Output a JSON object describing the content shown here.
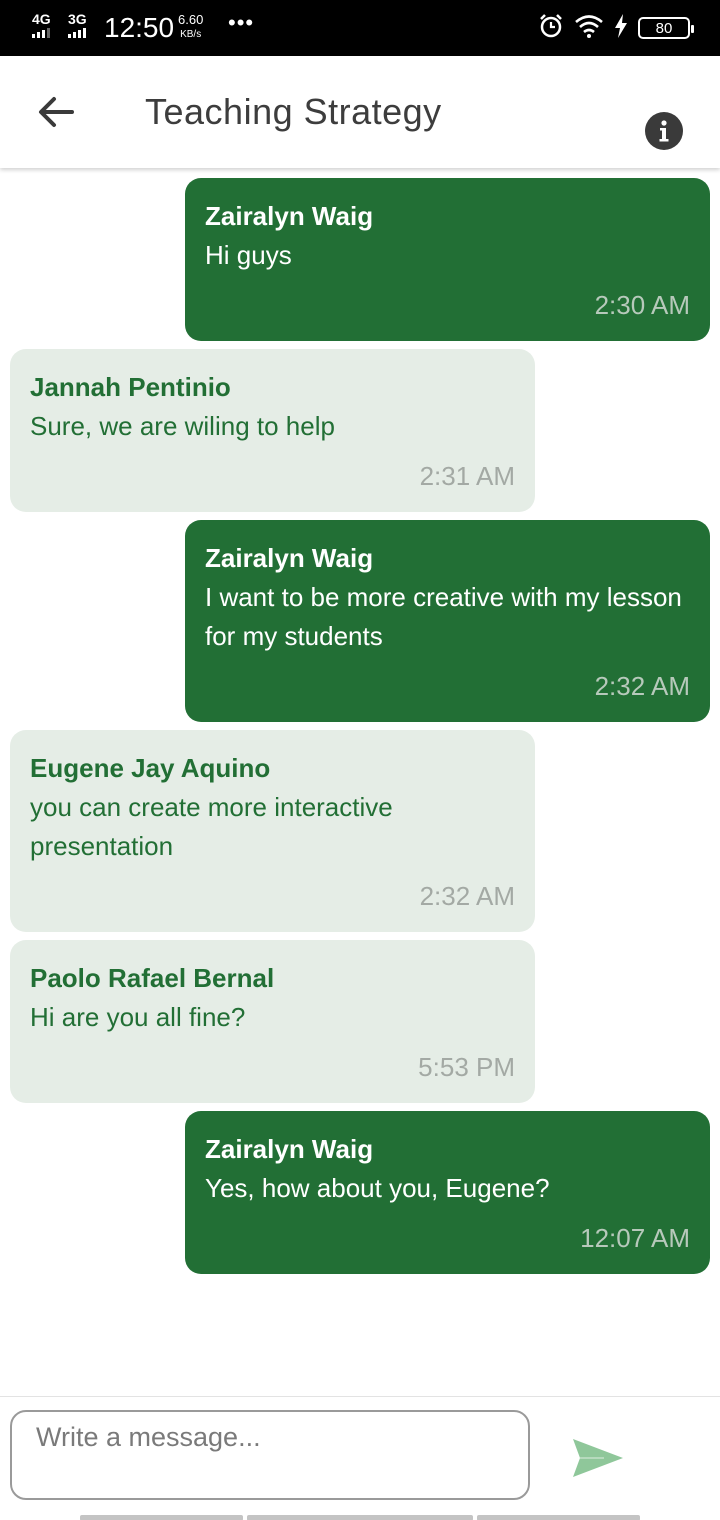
{
  "status_bar": {
    "network1": "4G",
    "network2": "3G",
    "time": "12:50",
    "speed_value": "6.60",
    "speed_unit": "KB/s",
    "more": "•••",
    "battery": "80"
  },
  "header": {
    "title": "Teaching Strategy",
    "back_icon": "arrow-left-icon",
    "info_icon": "info-icon"
  },
  "messages": [
    {
      "direction": "outgoing",
      "sender": "Zairalyn Waig",
      "text": "Hi guys",
      "time": "2:30 AM"
    },
    {
      "direction": "incoming",
      "sender": "Jannah Pentinio",
      "text": "Sure, we are wiling to help",
      "time": "2:31 AM"
    },
    {
      "direction": "outgoing",
      "sender": "Zairalyn Waig",
      "text": "I want to be more creative with my lesson for my students",
      "time": "2:32 AM"
    },
    {
      "direction": "incoming",
      "sender": "Eugene Jay Aquino",
      "text": "you can create more interactive presentation",
      "time": "2:32 AM"
    },
    {
      "direction": "incoming",
      "sender": "Paolo Rafael Bernal",
      "text": "Hi are you all fine?",
      "time": "5:53 PM"
    },
    {
      "direction": "outgoing",
      "sender": "Zairalyn Waig",
      "text": "Yes, how about you, Eugene?",
      "time": "12:07 AM"
    }
  ],
  "composer": {
    "placeholder": "Write a message...",
    "value": "",
    "send_icon": "send-icon"
  },
  "colors": {
    "outgoing_bubble": "#226f35",
    "incoming_bubble": "#e5ede6",
    "send_icon": "#8fc79a"
  }
}
